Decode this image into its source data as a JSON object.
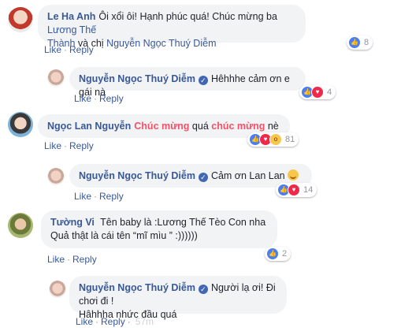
{
  "comments": [
    {
      "id": "c1",
      "name": "Le Ha Anh",
      "text_parts": [
        {
          "t": "Ôi xổi ôi! Hạnh phúc quá! Chúc mừng ba ",
          "s": "plain"
        },
        {
          "t": "Lương Thế",
          "s": "link"
        }
      ],
      "text_parts2": [
        {
          "t": "Thành",
          "s": "link"
        },
        {
          "t": " và chị ",
          "s": "plain"
        },
        {
          "t": "Nguyễn Ngọc Thuý Diễm",
          "s": "link"
        }
      ],
      "reaction_count": "8",
      "like": "Like",
      "reply": "Reply"
    },
    {
      "id": "r1",
      "name": "Nguyễn Ngọc Thuý Diễm",
      "text": "Hêhhhe cảm ơn e gái nà",
      "reaction_count": "4",
      "like": "Like",
      "reply": "Reply"
    },
    {
      "id": "c2",
      "name": "Ngọc Lan Nguyễn",
      "text_parts": [
        {
          "t": "Chúc mừng",
          "s": "hl"
        },
        {
          "t": " quá ",
          "s": "plain"
        },
        {
          "t": "chúc mừng",
          "s": "hl"
        },
        {
          "t": " nè",
          "s": "plain"
        }
      ],
      "reaction_count": "81",
      "like": "Like",
      "reply": "Reply"
    },
    {
      "id": "r2",
      "name": "Nguyễn Ngọc Thuý Diễm",
      "text": "Cảm ơn Lan Lan",
      "reaction_count": "14",
      "like": "Like",
      "reply": "Reply"
    },
    {
      "id": "c3",
      "name": "Tường Vi",
      "text": "Tên baby là :Lương Thế Tèo Con nha",
      "text2": "Quả thật là cái tên “mĩ mìu ” :))))))",
      "reaction_count": "2",
      "like": "Like",
      "reply": "Reply"
    },
    {
      "id": "r3",
      "name": "Nguyễn Ngọc Thuý Diễm",
      "text": "Người lạ ơi! Đi chơi đi !",
      "text2": "Hâhhha nhức đầu quá",
      "like": "Like",
      "reply": "Reply",
      "time": "57m"
    }
  ],
  "colors": {
    "link": "#385898",
    "highlight": "#f25268",
    "bubble": "#f2f3f5",
    "like_reaction": "#4a7ef5",
    "love_reaction": "#f0284a"
  },
  "icons": {
    "verified": "verified-badge-icon",
    "like": "like-reaction-icon",
    "love": "love-reaction-icon",
    "wow": "wow-reaction-icon",
    "smile": "smile-emoji-icon"
  }
}
